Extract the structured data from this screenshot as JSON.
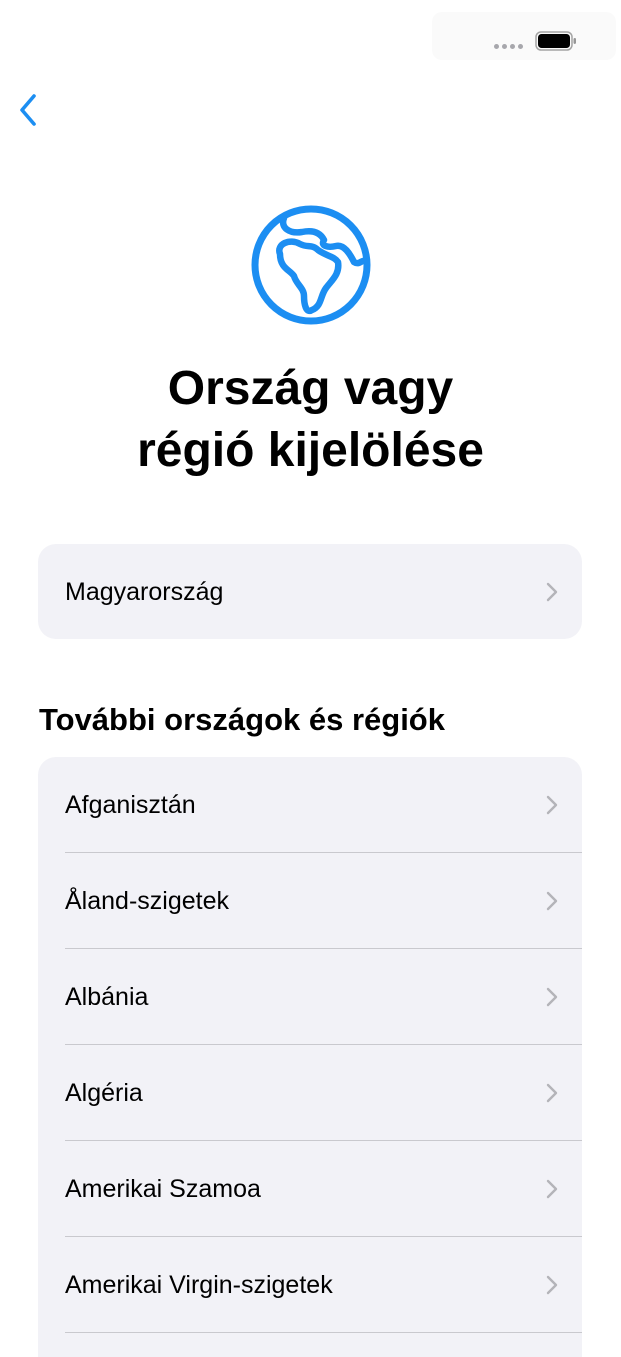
{
  "colors": {
    "accent": "#1c8ef2",
    "card_background": "#f2f2f7",
    "chevron": "#b4b4b9",
    "separator": "#c9c9ce"
  },
  "nav": {
    "back_icon": "chevron-left-icon"
  },
  "header": {
    "icon": "globe-africa-icon",
    "title": "Ország vagy\nrégió kijelölése"
  },
  "current_region": {
    "label": "Magyarország"
  },
  "more_section": {
    "title": "További országok és régiók",
    "items": [
      {
        "label": "Afganisztán"
      },
      {
        "label": "Åland-szigetek"
      },
      {
        "label": "Albánia"
      },
      {
        "label": "Algéria"
      },
      {
        "label": "Amerikai Szamoa"
      },
      {
        "label": "Amerikai Virgin-szigetek"
      }
    ]
  }
}
